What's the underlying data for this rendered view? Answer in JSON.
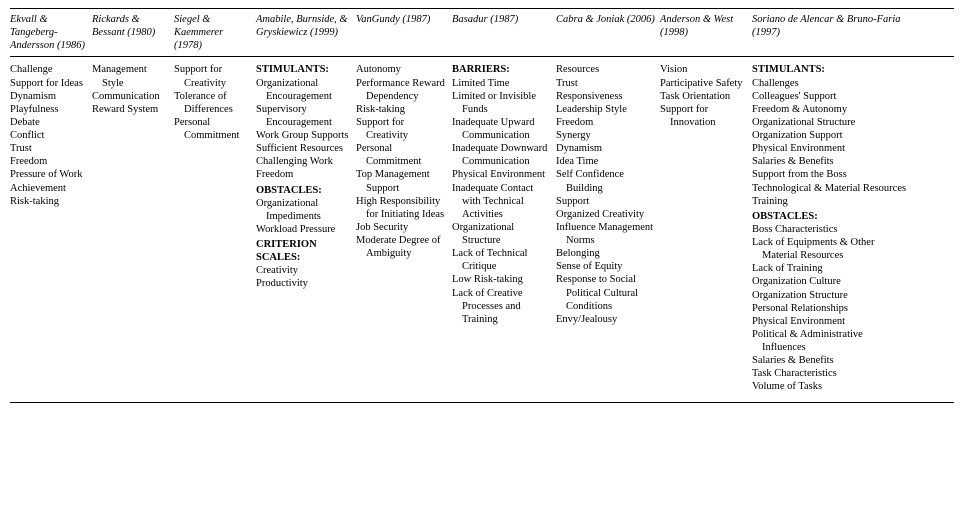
{
  "columns": [
    {
      "header": "Ekvall & Tangeberg-Andersson (1986)",
      "groups": [
        {
          "title": null,
          "items": [
            "Challenge",
            "Support for Ideas",
            "Dynamism",
            "Playfulness",
            "Debate",
            "Conflict",
            "Trust",
            "Freedom",
            "Pressure of Work",
            "Achievement",
            "Risk-taking"
          ]
        }
      ]
    },
    {
      "header": "Rickards & Bessant (1980)",
      "groups": [
        {
          "title": null,
          "items": [
            "Management Style",
            "Communication",
            "Reward System"
          ]
        }
      ]
    },
    {
      "header": "Siegel & Kaemmerer (1978)",
      "groups": [
        {
          "title": null,
          "items": [
            "Support for Creativity",
            "Tolerance of Differences",
            "Personal Commitment"
          ]
        }
      ]
    },
    {
      "header": "Amabile, Burnside, & Gryskiewicz (1999)",
      "groups": [
        {
          "title": "STIMULANTS:",
          "items": [
            "Organizational Encouragement",
            "Supervisory Encouragement",
            "Work Group Supports",
            "Sufficient Resources",
            "Challenging Work",
            "Freedom"
          ]
        },
        {
          "title": "OBSTACLES:",
          "items": [
            "Organizational Impediments",
            "Workload Pressure"
          ]
        },
        {
          "title": "CRITERION SCALES:",
          "items": [
            "Creativity",
            "Productivity"
          ]
        }
      ]
    },
    {
      "header": "VanGundy (1987)",
      "groups": [
        {
          "title": null,
          "items": [
            "Autonomy",
            "Performance Reward Dependency",
            "Risk-taking",
            "Support for Creativity",
            "Personal Commitment",
            "Top Management Support",
            "High Responsibility for Initiating Ideas",
            "Job Security",
            "Moderate Degree of Ambiguity"
          ]
        }
      ]
    },
    {
      "header": "Basadur (1987)",
      "groups": [
        {
          "title": "BARRIERS:",
          "items": [
            "Limited Time",
            "Limited or Invisible Funds",
            "Inadequate Upward Communication",
            "Inadequate Downward Communication",
            "Physical Environment",
            "Inadequate Contact with Technical Activities",
            "Organizational Structure",
            "Lack of Technical Critique",
            "Low Risk-taking",
            "Lack of Creative Processes and Training"
          ]
        }
      ]
    },
    {
      "header": "Cabra & Joniak (2006)",
      "groups": [
        {
          "title": null,
          "items": [
            "Resources",
            "Trust",
            "Responsiveness",
            "Leadership Style",
            "Freedom",
            "Synergy",
            "Dynamism",
            "Idea Time",
            "Self Confidence Building",
            "Support",
            "Organized Creativity",
            "Influence Management Norms",
            "Belonging",
            "Sense of Equity",
            "Response to Social Political Cultural Conditions",
            "Envy/Jealousy"
          ]
        }
      ]
    },
    {
      "header": "Anderson & West (1998)",
      "groups": [
        {
          "title": null,
          "items": [
            "Vision",
            "Participative Safety",
            "Task Orientation",
            "Support for Innovation"
          ]
        }
      ]
    },
    {
      "header": "Soriano de Alencar & Bruno-Faria (1997)",
      "groups": [
        {
          "title": "STIMULANTS:",
          "items": [
            "Challenges",
            "Colleagues' Support",
            "Freedom & Autonomy",
            "Organizational Structure",
            "Organization Support",
            "Physical Environment",
            "Salaries & Benefits",
            "Support from the Boss",
            "Technological & Material Resources",
            "Training"
          ]
        },
        {
          "title": "OBSTACLES:",
          "items": [
            "Boss Characteristics",
            "Lack of Equipments & Other Material Resources",
            "Lack of Training",
            "Organization Culture",
            "Organization Structure",
            "Personal Relationships",
            "Physical Environment",
            "Political & Administrative Influences",
            "Salaries & Benefits",
            "Task Characteristics",
            "Volume of Tasks"
          ]
        }
      ]
    }
  ]
}
